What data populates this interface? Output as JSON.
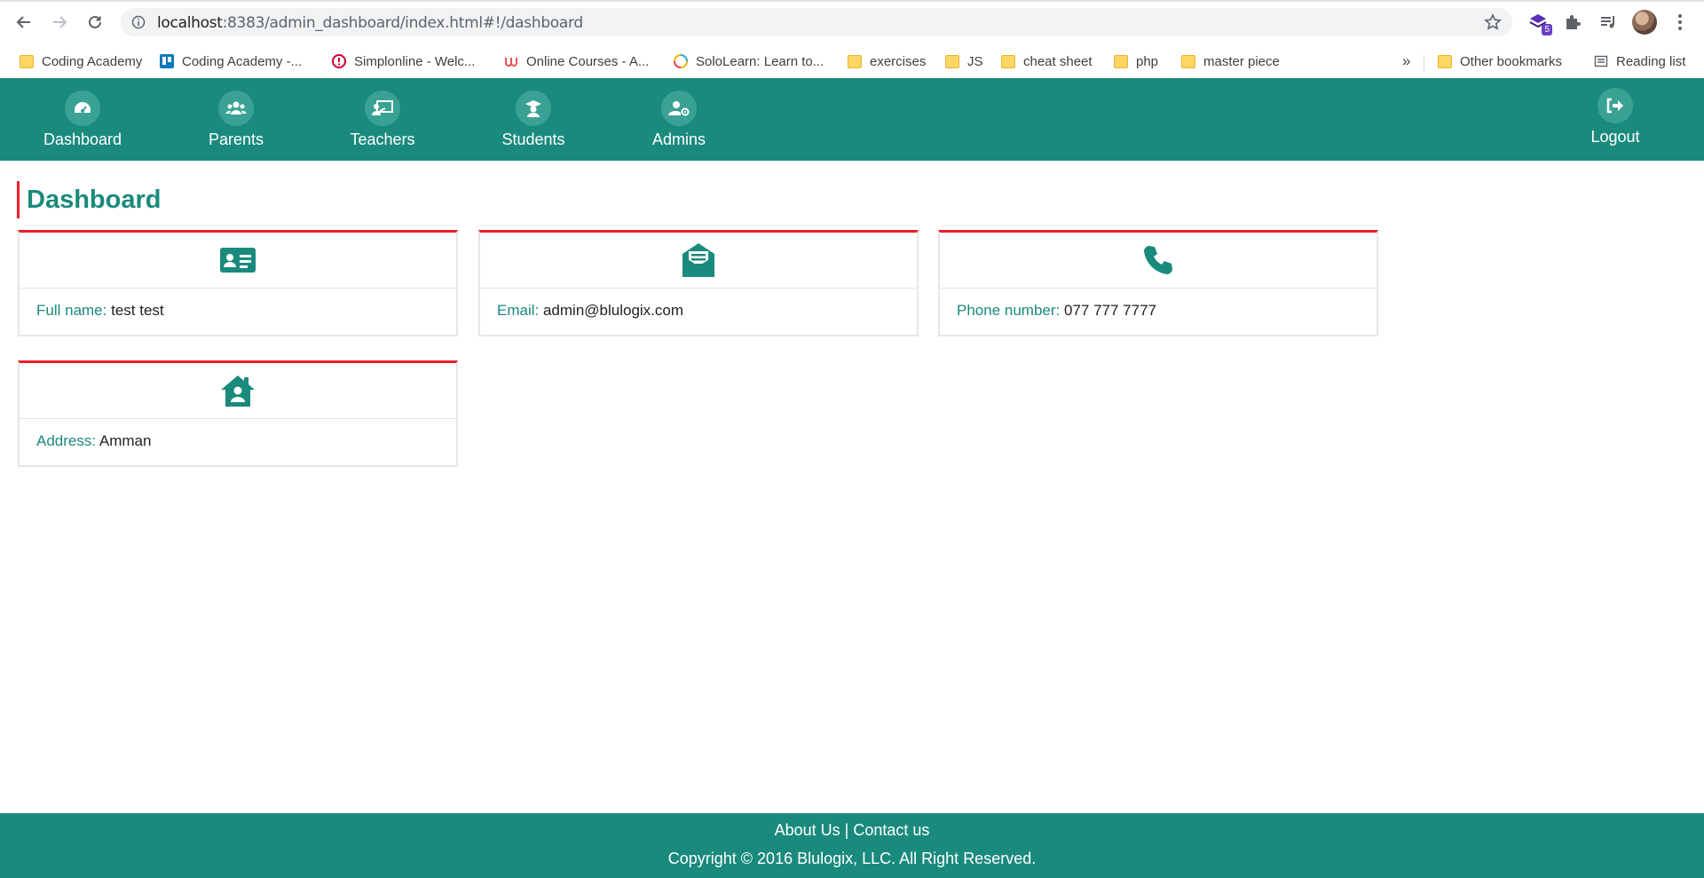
{
  "browser": {
    "url_host": "localhost",
    "url_rest": ":8383/admin_dashboard/index.html#!/dashboard",
    "extension_badge": "5",
    "bookmarks": [
      {
        "label": "Coding Academy",
        "icon": "folder-icon"
      },
      {
        "label": "Coding Academy -...",
        "icon": "trello-icon"
      },
      {
        "label": "Simplonline - Welc...",
        "icon": "simplon-icon"
      },
      {
        "label": "Online Courses - A...",
        "icon": "udemy-icon"
      },
      {
        "label": "SoloLearn: Learn to...",
        "icon": "sololearn-icon"
      },
      {
        "label": "exercises",
        "icon": "folder-icon"
      },
      {
        "label": "JS",
        "icon": "folder-icon"
      },
      {
        "label": "cheat sheet",
        "icon": "folder-icon"
      },
      {
        "label": "php",
        "icon": "folder-icon"
      },
      {
        "label": "master piece",
        "icon": "folder-icon"
      }
    ],
    "overflow_label": "»",
    "other_bookmarks": "Other bookmarks",
    "reading_list": "Reading list"
  },
  "nav": {
    "items": [
      {
        "label": "Dashboard",
        "icon": "gauge-icon"
      },
      {
        "label": "Parents",
        "icon": "users-icon"
      },
      {
        "label": "Teachers",
        "icon": "chalkboard-teacher-icon"
      },
      {
        "label": "Students",
        "icon": "graduate-icon"
      },
      {
        "label": "Admins",
        "icon": "user-cog-icon"
      }
    ],
    "logout": {
      "label": "Logout",
      "icon": "sign-out-icon"
    }
  },
  "main": {
    "title": "Dashboard",
    "cards": [
      {
        "key": "Full name:",
        "value": "test test",
        "icon": "id-card-icon"
      },
      {
        "key": "Email:",
        "value": "admin@blulogix.com",
        "icon": "envelope-open-icon"
      },
      {
        "key": "Phone number:",
        "value": "077 777 7777",
        "icon": "phone-icon"
      },
      {
        "key": "Address:",
        "value": "Amman",
        "icon": "house-user-icon"
      }
    ]
  },
  "footer": {
    "about": "About Us",
    "separator": "|",
    "contact": "Contact us",
    "copyright": "Copyright © 2016 Blulogix, LLC. All Right Reserved."
  },
  "colors": {
    "primary": "#1a8a7d",
    "accent": "#e8202a"
  }
}
